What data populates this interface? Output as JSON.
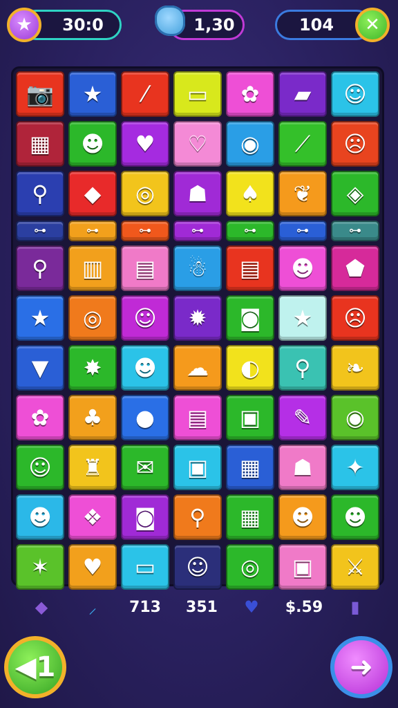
{
  "hud": {
    "left_value": "30:0",
    "middle_value": "1,30",
    "right_value": "104",
    "left_icon": "star-icon",
    "middle_icon": "gem-icon",
    "right_icon": "close-icon"
  },
  "board": {
    "rows": [
      {
        "type": "tile",
        "tiles": [
          {
            "icon": "camera-icon",
            "glyph": "📷",
            "color": "#e8341f"
          },
          {
            "icon": "star-icon",
            "glyph": "★",
            "color": "#2a5fd6"
          },
          {
            "icon": "slash-icon",
            "glyph": "⁄",
            "color": "#e8341f"
          },
          {
            "icon": "pillow-icon",
            "glyph": "▭",
            "color": "#d8e81c"
          },
          {
            "icon": "flower-icon",
            "glyph": "✿",
            "color": "#ee4fd6"
          },
          {
            "icon": "ticket-icon",
            "glyph": "▰",
            "color": "#7a2ac9"
          },
          {
            "icon": "robot-icon",
            "glyph": "☺",
            "color": "#2bc3e8"
          }
        ]
      },
      {
        "type": "tile",
        "tiles": [
          {
            "icon": "calendar-icon",
            "glyph": "▦",
            "color": "#b0243a"
          },
          {
            "icon": "monster-icon",
            "glyph": "☻",
            "color": "#2cb82a"
          },
          {
            "icon": "heart-icon",
            "glyph": "♥",
            "color": "#a52be0"
          },
          {
            "icon": "heart-outline-icon",
            "glyph": "♡",
            "color": "#f48ad6"
          },
          {
            "icon": "camera-icon",
            "glyph": "◉",
            "color": "#2a9ee6"
          },
          {
            "icon": "leaf-icon",
            "glyph": "⟋",
            "color": "#34c02a"
          },
          {
            "icon": "ghost-icon",
            "glyph": "☹",
            "color": "#e8441f"
          }
        ]
      },
      {
        "type": "tile",
        "tiles": [
          {
            "icon": "drumstick-icon",
            "glyph": "⚲",
            "color": "#2b3fb0"
          },
          {
            "icon": "shield-icon",
            "glyph": "◆",
            "color": "#e82a2a"
          },
          {
            "icon": "spiral-icon",
            "glyph": "◎",
            "color": "#f2c41c"
          },
          {
            "icon": "cat-icon",
            "glyph": "☗",
            "color": "#a02ad6"
          },
          {
            "icon": "squid-icon",
            "glyph": "♠",
            "color": "#f2e21c"
          },
          {
            "icon": "feather-icon",
            "glyph": "❦",
            "color": "#f59a1c"
          },
          {
            "icon": "candy-icon",
            "glyph": "◈",
            "color": "#2cb82a"
          }
        ]
      },
      {
        "type": "bar",
        "tiles": [
          {
            "icon": "dumbbell-icon",
            "glyph": "⊶",
            "color": "#2b3fa0"
          },
          {
            "icon": "dumbbell-icon",
            "glyph": "⊶",
            "color": "#f2a01c"
          },
          {
            "icon": "dumbbell-icon",
            "glyph": "⊶",
            "color": "#f0581c"
          },
          {
            "icon": "dumbbell-icon",
            "glyph": "⊶",
            "color": "#a02ad6"
          },
          {
            "icon": "dumbbell-icon",
            "glyph": "⊶",
            "color": "#2cb82a"
          },
          {
            "icon": "dumbbell-icon",
            "glyph": "⊶",
            "color": "#2a5fd6"
          },
          {
            "icon": "dumbbell-icon",
            "glyph": "⊶",
            "color": "#3a8a8a"
          }
        ]
      },
      {
        "type": "tile",
        "tiles": [
          {
            "icon": "magnifier-icon",
            "glyph": "⚲",
            "color": "#7a2a9a"
          },
          {
            "icon": "window-icon",
            "glyph": "▥",
            "color": "#f2a01c"
          },
          {
            "icon": "scroll-icon",
            "glyph": "▤",
            "color": "#f07ac8"
          },
          {
            "icon": "ghost-icon",
            "glyph": "☃",
            "color": "#2a9ee6"
          },
          {
            "icon": "document-icon",
            "glyph": "▤",
            "color": "#e8341f"
          },
          {
            "icon": "alien-icon",
            "glyph": "☻",
            "color": "#ee4fd6"
          },
          {
            "icon": "badge-icon",
            "glyph": "⬟",
            "color": "#d62a9a"
          }
        ]
      },
      {
        "type": "tile",
        "tiles": [
          {
            "icon": "star-icon",
            "glyph": "★",
            "color": "#2a6fe6"
          },
          {
            "icon": "swirl-icon",
            "glyph": "◎",
            "color": "#f07a1c"
          },
          {
            "icon": "face-icon",
            "glyph": "☺",
            "color": "#c02ad6"
          },
          {
            "icon": "star-badge-icon",
            "glyph": "✹",
            "color": "#7a2ac9"
          },
          {
            "icon": "camera-icon",
            "glyph": "◙",
            "color": "#2cb82a"
          },
          {
            "icon": "star-icon",
            "glyph": "★",
            "color": "#bff2ee"
          },
          {
            "icon": "mask-icon",
            "glyph": "☹",
            "color": "#e8341f"
          }
        ]
      },
      {
        "type": "tile",
        "tiles": [
          {
            "icon": "icecream-icon",
            "glyph": "▼",
            "color": "#2a5fd6"
          },
          {
            "icon": "puzzle-icon",
            "glyph": "✸",
            "color": "#2cb82a"
          },
          {
            "icon": "bear-icon",
            "glyph": "☻",
            "color": "#2bc3e8"
          },
          {
            "icon": "cloud-icon",
            "glyph": "☁",
            "color": "#f59a1c"
          },
          {
            "icon": "pin-icon",
            "glyph": "◐",
            "color": "#f2e21c"
          },
          {
            "icon": "magnifier-icon",
            "glyph": "⚲",
            "color": "#3ac2b2"
          },
          {
            "icon": "leaf-icon",
            "glyph": "❧",
            "color": "#f2c41c"
          }
        ]
      },
      {
        "type": "tile",
        "tiles": [
          {
            "icon": "flower-icon",
            "glyph": "✿",
            "color": "#ee4fd6"
          },
          {
            "icon": "shell-icon",
            "glyph": "♣",
            "color": "#f2a01c"
          },
          {
            "icon": "orange-icon",
            "glyph": "●",
            "color": "#2a6fe6"
          },
          {
            "icon": "clipboard-icon",
            "glyph": "▤",
            "color": "#ee4fd6"
          },
          {
            "icon": "briefcase-icon",
            "glyph": "▣",
            "color": "#2cb82a"
          },
          {
            "icon": "pen-icon",
            "glyph": "✎",
            "color": "#b52fe6"
          },
          {
            "icon": "camera-icon",
            "glyph": "◉",
            "color": "#5ac22a"
          }
        ]
      },
      {
        "type": "tile",
        "tiles": [
          {
            "icon": "sun-face-icon",
            "glyph": "☺",
            "color": "#2cb82a"
          },
          {
            "icon": "bottle-icon",
            "glyph": "♜",
            "color": "#f2c41c"
          },
          {
            "icon": "scroll-icon",
            "glyph": "✉",
            "color": "#2cb82a"
          },
          {
            "icon": "bag-icon",
            "glyph": "▣",
            "color": "#2bc3e8"
          },
          {
            "icon": "card-icon",
            "glyph": "▦",
            "color": "#2a5fd6"
          },
          {
            "icon": "ghost-icon",
            "glyph": "☗",
            "color": "#f07ac8"
          },
          {
            "icon": "maple-leaf-icon",
            "glyph": "✦",
            "color": "#2bc3e8"
          }
        ]
      },
      {
        "type": "tile",
        "tiles": [
          {
            "icon": "bear-icon",
            "glyph": "☻",
            "color": "#2bb8e8"
          },
          {
            "icon": "fish-icon",
            "glyph": "❖",
            "color": "#ee4fd6"
          },
          {
            "icon": "camera-icon",
            "glyph": "◙",
            "color": "#a02ad6"
          },
          {
            "icon": "pin-icon",
            "glyph": "⚲",
            "color": "#f07a1c"
          },
          {
            "icon": "keyboard-icon",
            "glyph": "▦",
            "color": "#2cb82a"
          },
          {
            "icon": "bear-icon",
            "glyph": "☻",
            "color": "#f59a1c"
          },
          {
            "icon": "monkey-icon",
            "glyph": "☻",
            "color": "#2cb82a"
          }
        ]
      },
      {
        "type": "tile",
        "tiles": [
          {
            "icon": "star-icon",
            "glyph": "✶",
            "color": "#5ac22a"
          },
          {
            "icon": "heart-icon",
            "glyph": "♥",
            "color": "#f2a01c"
          },
          {
            "icon": "chest-icon",
            "glyph": "▭",
            "color": "#2bc3e8"
          },
          {
            "icon": "face-icon",
            "glyph": "☺",
            "color": "#2b2f7a"
          },
          {
            "icon": "target-icon",
            "glyph": "◎",
            "color": "#2cb82a"
          },
          {
            "icon": "tv-icon",
            "glyph": "▣",
            "color": "#f07ac8"
          },
          {
            "icon": "shield-icon",
            "glyph": "⚔",
            "color": "#f2c41c"
          }
        ]
      }
    ]
  },
  "stats": [
    {
      "icon": "cube-icon",
      "glyph": "◆",
      "color": "#8a5ad6",
      "text": ""
    },
    {
      "icon": "feather-icon",
      "glyph": "⸝",
      "color": "#3aa6e8",
      "text": ""
    },
    {
      "icon": "",
      "glyph": "",
      "color": "",
      "text": "713"
    },
    {
      "icon": "",
      "glyph": "",
      "color": "",
      "text": "351"
    },
    {
      "icon": "heart-icon",
      "glyph": "♥",
      "color": "#3a4fd6",
      "text": ""
    },
    {
      "icon": "",
      "glyph": "",
      "color": "",
      "text": "$.59"
    },
    {
      "icon": "phone-icon",
      "glyph": "▮",
      "color": "#7a5ad6",
      "text": ""
    }
  ],
  "buttons": {
    "back_glyph": "◀1",
    "next_glyph": "➜"
  }
}
